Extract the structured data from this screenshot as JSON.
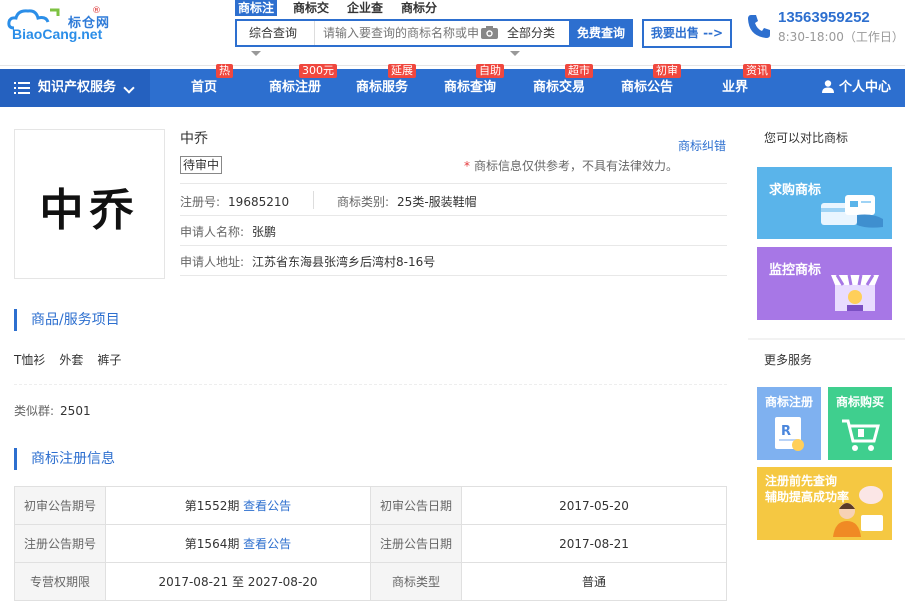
{
  "header": {
    "logo_cn": "标仓网",
    "logo_en_prefix": "BiaoCang",
    "logo_en_suffix": ".net",
    "logo_reg": "®",
    "search_tabs": [
      "商标注",
      "商标交易",
      "企业查",
      "商标分"
    ],
    "search_type": "综合查询",
    "search_placeholder": "请输入要查询的商标名称或申请号",
    "search_category": "全部分类",
    "search_button": "免费查询",
    "sell_button": "我要出售 -->",
    "phone": "13563959252",
    "hours": "8:30-18:00（工作日）"
  },
  "nav": {
    "services": "知识产权服务",
    "items": [
      {
        "label": "首页",
        "badge": "热"
      },
      {
        "label": "商标注册",
        "badge": "300元"
      },
      {
        "label": "商标服务",
        "badge": "延展"
      },
      {
        "label": "商标查询",
        "badge": "自助"
      },
      {
        "label": "商标交易",
        "badge": "超市"
      },
      {
        "label": "商标公告",
        "badge": "初审"
      },
      {
        "label": "业界",
        "badge": "资讯"
      }
    ],
    "user": "个人中心"
  },
  "trademark": {
    "mark_text": "中乔",
    "name": "中乔",
    "status": "待审中",
    "correct_link": "商标纠错",
    "disclaimer": "商标信息仅供参考，不具有法律效力。",
    "reg_no_label": "注册号:",
    "reg_no": "19685210",
    "class_label": "商标类别:",
    "class": "25类-服装鞋帽",
    "applicant_label": "申请人名称:",
    "applicant": "张鹏",
    "address_label": "申请人地址:",
    "address": "江苏省东海县张湾乡后湾村8-16号"
  },
  "goods_section": {
    "title": "商品/服务项目",
    "items": [
      "T恤衫",
      "外套",
      "裤子"
    ],
    "similar_label": "类似群:",
    "similar_value": "2501"
  },
  "registration_section": {
    "title": "商标注册信息",
    "rows": [
      {
        "l1": "初审公告期号",
        "v1": "第1552期",
        "link1": "查看公告",
        "l2": "初审公告日期",
        "v2": "2017-05-20"
      },
      {
        "l1": "注册公告期号",
        "v1": "第1564期",
        "link1": "查看公告",
        "l2": "注册公告日期",
        "v2": "2017-08-21"
      },
      {
        "l1": "专营权期限",
        "v1": "2017-08-21 至 2027-08-20",
        "link1": "",
        "l2": "商标类型",
        "v2": "普通"
      }
    ]
  },
  "sidebar": {
    "compare_title": "您可以对比商标",
    "buy_label": "求购商标",
    "monitor_label": "监控商标",
    "more_title": "更多服务",
    "register_label": "商标注册",
    "purchase_label": "商标购买",
    "consult_line1": "注册前先查询",
    "consult_line2": "辅助提高成功率"
  },
  "colors": {
    "primary": "#2d6fcf",
    "badge": "#f0473e",
    "buy_card": "#5ab4ea",
    "monitor_card": "#a777e6",
    "register_card": "#7fb1f0",
    "purchase_card": "#3fcf8e",
    "consult_card": "#f5c842"
  }
}
